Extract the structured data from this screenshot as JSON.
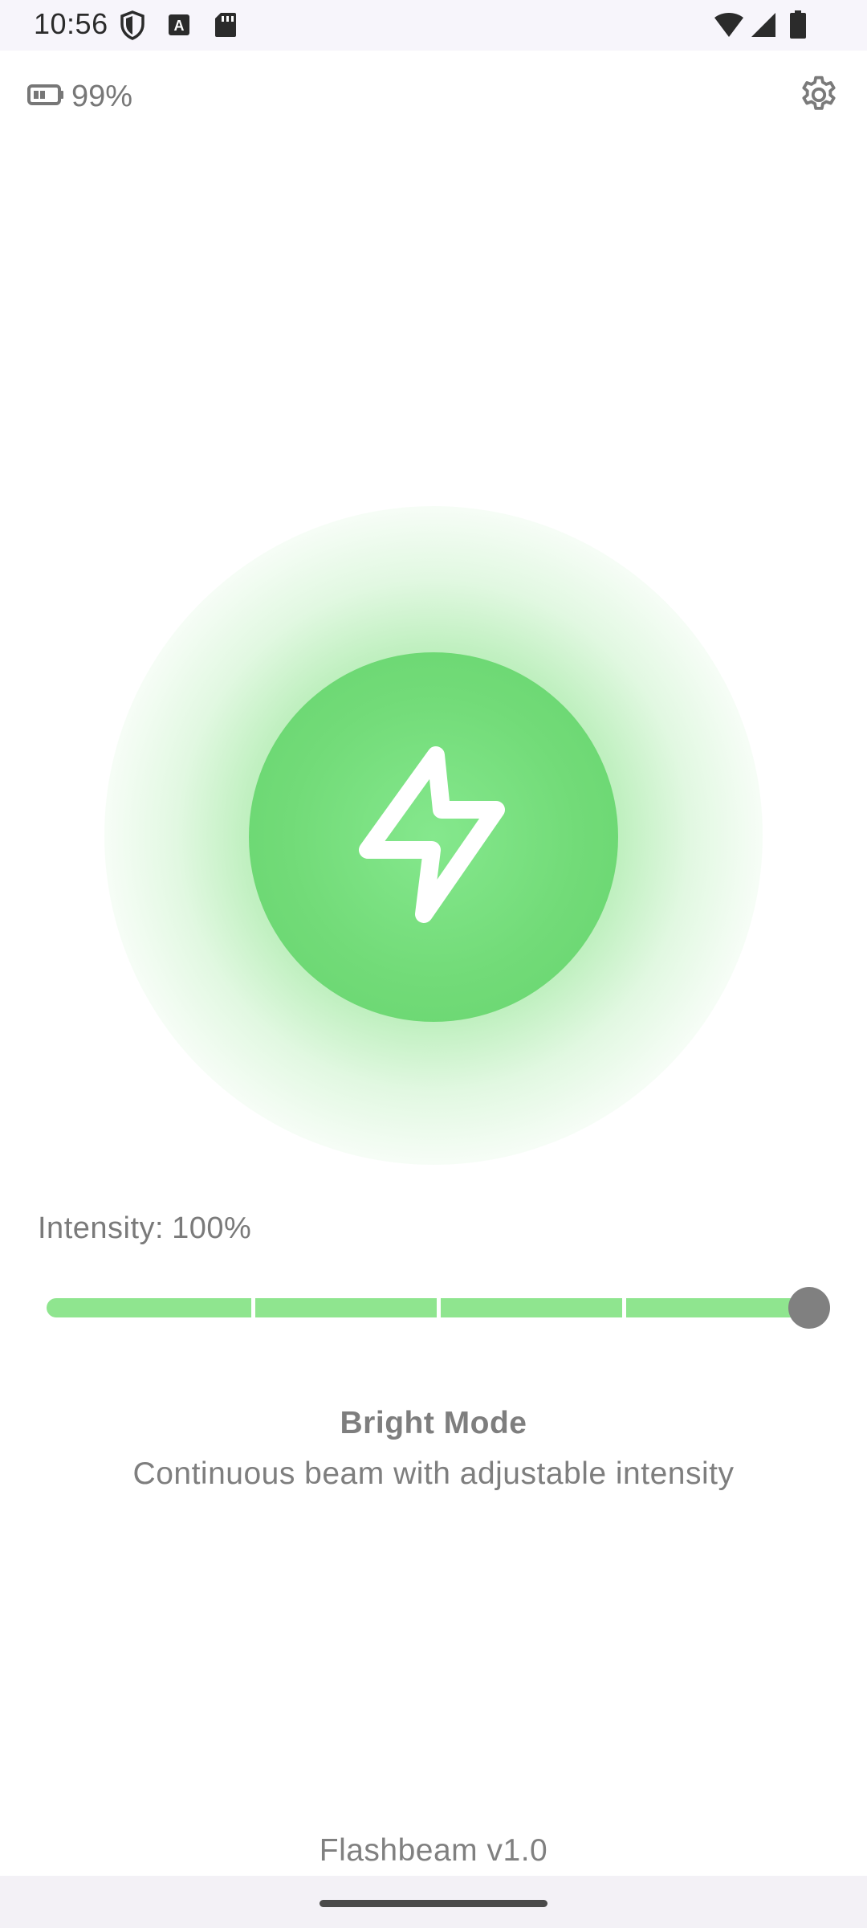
{
  "status_bar": {
    "time": "10:56",
    "left_icons": [
      "shield-icon",
      "font-a-icon",
      "sd-card-icon"
    ],
    "right_icons": [
      "wifi-icon",
      "cell-signal-icon",
      "battery-full-icon"
    ]
  },
  "top_bar": {
    "battery_icon": "battery-low-icon",
    "battery_percent": "99%",
    "settings_icon": "gear-icon"
  },
  "power_button": {
    "icon": "lightning-bolt-icon",
    "state": "on",
    "color": "#6ed974",
    "glow_color": "#8fe58f"
  },
  "intensity": {
    "label": "Intensity:",
    "value_text": "100%",
    "value": 1.0,
    "track_color": "#8fe58f",
    "thumb_color": "#808080",
    "steps": 4
  },
  "mode": {
    "title": "Bright Mode",
    "description": "Continuous beam with adjustable intensity"
  },
  "footer": {
    "version": "Flashbeam v1.0"
  }
}
